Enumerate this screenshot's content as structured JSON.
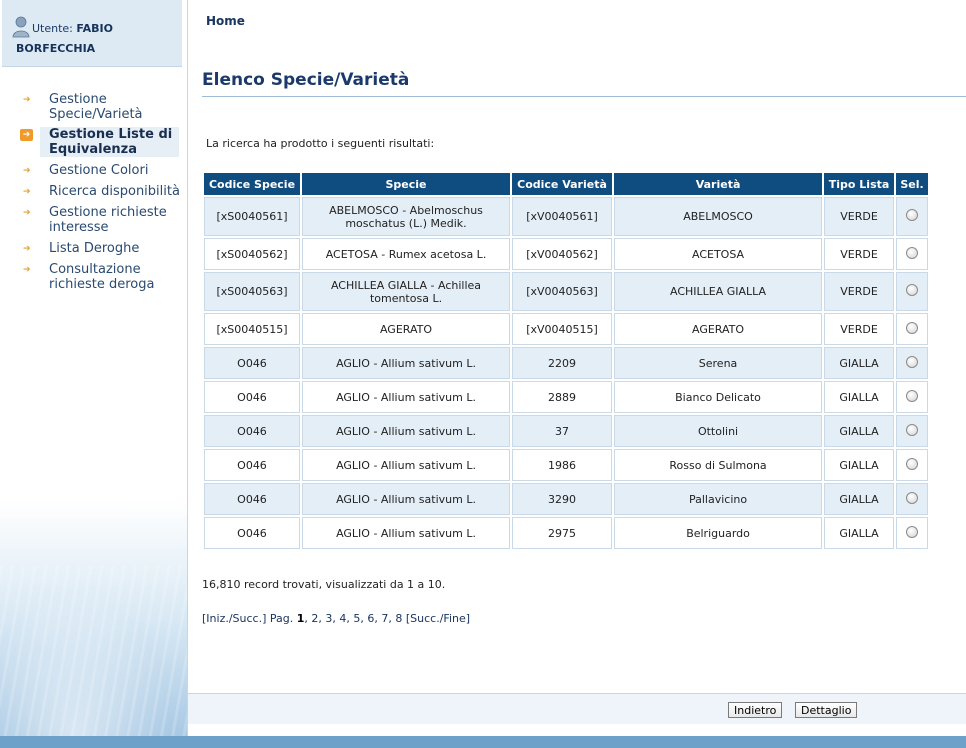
{
  "user": {
    "prefix": "Utente:",
    "first_name": "FABIO",
    "last_name": "BORFECCHIA"
  },
  "menu": [
    {
      "label": "Gestione Specie/Varietà",
      "active": false
    },
    {
      "label": "Gestione Liste di Equivalenza",
      "active": true
    },
    {
      "label": "Gestione Colori",
      "active": false
    },
    {
      "label": "Ricerca disponibilità",
      "active": false
    },
    {
      "label": "Gestione richieste interesse",
      "active": false
    },
    {
      "label": "Lista Deroghe",
      "active": false
    },
    {
      "label": "Consultazione richieste deroga",
      "active": false
    }
  ],
  "breadcrumb": "Home",
  "page_title": "Elenco Specie/Varietà",
  "intro": "La ricerca ha prodotto i seguenti risultati:",
  "table": {
    "headers": [
      "Codice Specie",
      "Specie",
      "Codice Varietà",
      "Varietà",
      "Tipo Lista",
      "Sel."
    ],
    "rows": [
      [
        "[xS0040561]",
        "ABELMOSCO - Abelmoschus moschatus (L.) Medik.",
        "[xV0040561]",
        "ABELMOSCO",
        "VERDE"
      ],
      [
        "[xS0040562]",
        "ACETOSA - Rumex acetosa L.",
        "[xV0040562]",
        "ACETOSA",
        "VERDE"
      ],
      [
        "[xS0040563]",
        "ACHILLEA GIALLA - Achillea tomentosa L.",
        "[xV0040563]",
        "ACHILLEA GIALLA",
        "VERDE"
      ],
      [
        "[xS0040515]",
        "AGERATO",
        "[xV0040515]",
        "AGERATO",
        "VERDE"
      ],
      [
        "O046",
        "AGLIO - Allium sativum L.",
        "2209",
        "Serena",
        "GIALLA"
      ],
      [
        "O046",
        "AGLIO - Allium sativum L.",
        "2889",
        "Bianco Delicato",
        "GIALLA"
      ],
      [
        "O046",
        "AGLIO - Allium sativum L.",
        "37",
        "Ottolini",
        "GIALLA"
      ],
      [
        "O046",
        "AGLIO - Allium sativum L.",
        "1986",
        "Rosso di Sulmona",
        "GIALLA"
      ],
      [
        "O046",
        "AGLIO - Allium sativum L.",
        "3290",
        "Pallavicino",
        "GIALLA"
      ],
      [
        "O046",
        "AGLIO - Allium sativum L.",
        "2975",
        "Belriguardo",
        "GIALLA"
      ]
    ]
  },
  "record_count": "16,810 record trovati, visualizzati da 1 a 10.",
  "pager": {
    "prefix": "[Iniz./Succ.] Pag.",
    "current": "1",
    "pages": [
      "2",
      "3",
      "4",
      "5",
      "6",
      "7",
      "8"
    ],
    "suffix": "[Succ./Fine]"
  },
  "buttons": {
    "back": "Indietro",
    "detail": "Dettaglio"
  },
  "colors": {
    "header_bg": "#0f4c80",
    "row_alt": "#e4eef7",
    "accent": "#f09a2a"
  }
}
